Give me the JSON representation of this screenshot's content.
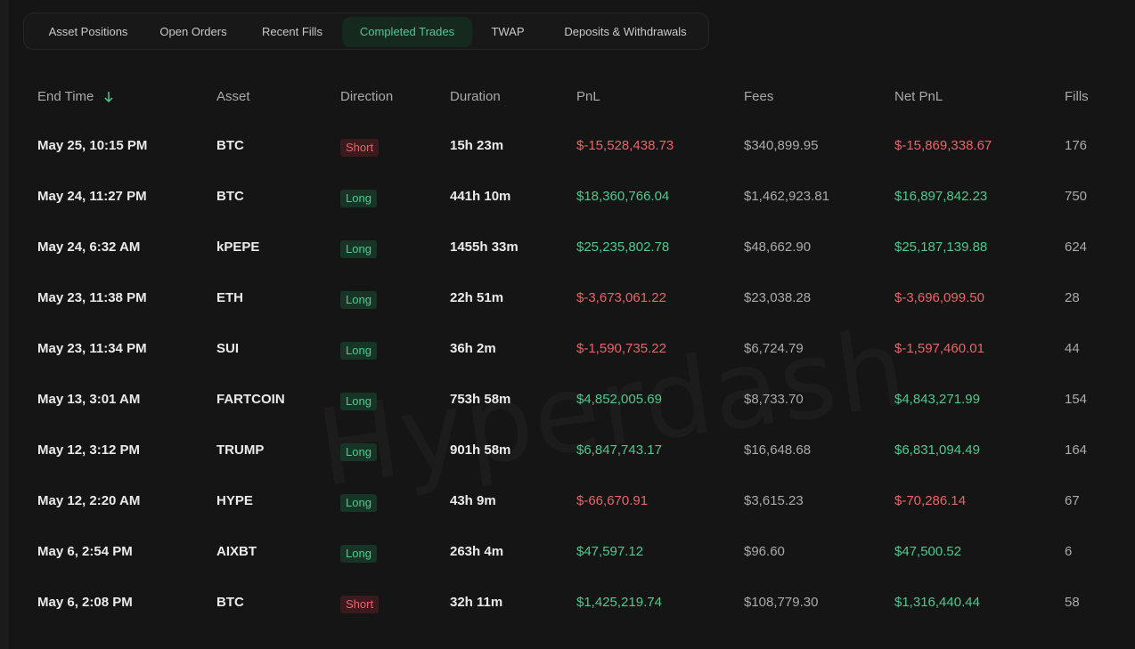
{
  "tabs": [
    {
      "label": "Asset Positions",
      "active": false
    },
    {
      "label": "Open Orders",
      "active": false
    },
    {
      "label": "Recent Fills",
      "active": false
    },
    {
      "label": "Completed Trades",
      "active": true
    },
    {
      "label": "TWAP",
      "active": false
    },
    {
      "label": "Deposits & Withdrawals",
      "active": false
    }
  ],
  "watermark": "Hyperdash",
  "table": {
    "headers": {
      "end_time": "End Time",
      "asset": "Asset",
      "direction": "Direction",
      "duration": "Duration",
      "pnl": "PnL",
      "fees": "Fees",
      "net_pnl": "Net PnL",
      "fills": "Fills"
    },
    "sort_icon": "arrow-down-icon",
    "rows": [
      {
        "end_time": "May 25, 10:15 PM",
        "asset": "BTC",
        "direction": "Short",
        "duration": "15h 23m",
        "pnl": "$-15,528,438.73",
        "fees": "$340,899.95",
        "net_pnl": "$-15,869,338.67",
        "fills": "176"
      },
      {
        "end_time": "May 24, 11:27 PM",
        "asset": "BTC",
        "direction": "Long",
        "duration": "441h 10m",
        "pnl": "$18,360,766.04",
        "fees": "$1,462,923.81",
        "net_pnl": "$16,897,842.23",
        "fills": "750"
      },
      {
        "end_time": "May 24, 6:32 AM",
        "asset": "kPEPE",
        "direction": "Long",
        "duration": "1455h 33m",
        "pnl": "$25,235,802.78",
        "fees": "$48,662.90",
        "net_pnl": "$25,187,139.88",
        "fills": "624"
      },
      {
        "end_time": "May 23, 11:38 PM",
        "asset": "ETH",
        "direction": "Long",
        "duration": "22h 51m",
        "pnl": "$-3,673,061.22",
        "fees": "$23,038.28",
        "net_pnl": "$-3,696,099.50",
        "fills": "28"
      },
      {
        "end_time": "May 23, 11:34 PM",
        "asset": "SUI",
        "direction": "Long",
        "duration": "36h 2m",
        "pnl": "$-1,590,735.22",
        "fees": "$6,724.79",
        "net_pnl": "$-1,597,460.01",
        "fills": "44"
      },
      {
        "end_time": "May 13, 3:01 AM",
        "asset": "FARTCOIN",
        "direction": "Long",
        "duration": "753h 58m",
        "pnl": "$4,852,005.69",
        "fees": "$8,733.70",
        "net_pnl": "$4,843,271.99",
        "fills": "154"
      },
      {
        "end_time": "May 12, 3:12 PM",
        "asset": "TRUMP",
        "direction": "Long",
        "duration": "901h 58m",
        "pnl": "$6,847,743.17",
        "fees": "$16,648.68",
        "net_pnl": "$6,831,094.49",
        "fills": "164"
      },
      {
        "end_time": "May 12, 2:20 AM",
        "asset": "HYPE",
        "direction": "Long",
        "duration": "43h 9m",
        "pnl": "$-66,670.91",
        "fees": "$3,615.23",
        "net_pnl": "$-70,286.14",
        "fills": "67"
      },
      {
        "end_time": "May 6, 2:54 PM",
        "asset": "AIXBT",
        "direction": "Long",
        "duration": "263h 4m",
        "pnl": "$47,597.12",
        "fees": "$96.60",
        "net_pnl": "$47,500.52",
        "fills": "6"
      },
      {
        "end_time": "May 6, 2:08 PM",
        "asset": "BTC",
        "direction": "Short",
        "duration": "32h 11m",
        "pnl": "$1,425,219.74",
        "fees": "$108,779.30",
        "net_pnl": "$1,316,440.44",
        "fills": "58"
      }
    ]
  },
  "colors": {
    "positive": "#4fc98e",
    "negative": "#e8646a",
    "background": "#151515"
  }
}
